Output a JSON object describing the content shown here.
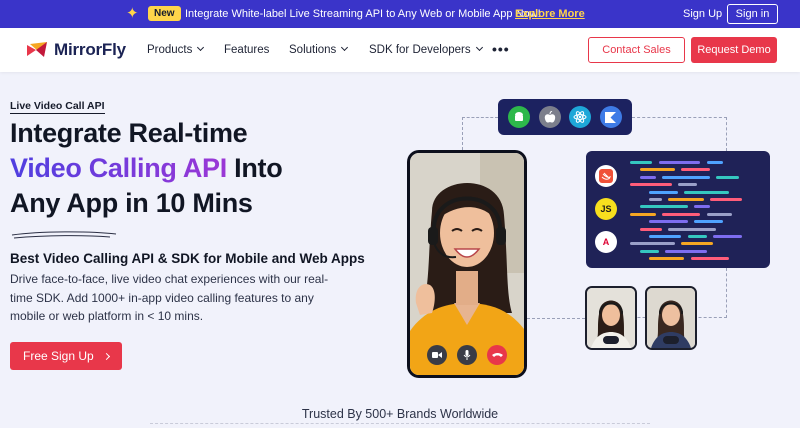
{
  "announcement": {
    "badge": "New",
    "text": "Integrate White-label Live Streaming API to Any Web or Mobile App Now!",
    "link": "Explore More",
    "sign_up": "Sign Up",
    "sign_in": "Sign in"
  },
  "nav": {
    "logo": "MirrorFly",
    "items": [
      "Products",
      "Features",
      "Solutions",
      "SDK for Developers"
    ],
    "more": "•••",
    "contact": "Contact Sales",
    "demo": "Request Demo"
  },
  "hero": {
    "eyebrow": "Live Video Call API",
    "headline_1": "Integrate Real-time",
    "headline_2a": "Video Calling API",
    "headline_2b": " Into",
    "headline_3": "Any App in 10 Mins",
    "subhead": "Best Video Calling API & SDK for Mobile and Web Apps",
    "body": "Drive face-to-face, live video chat experiences with our real-time SDK. Add 1000+ in-app video calling features to any mobile or web platform in < 10 mins.",
    "cta": "Free Sign Up"
  },
  "illustration": {
    "platforms": [
      "android-icon",
      "apple-icon",
      "react-icon",
      "kotlin-icon"
    ],
    "code_langs": [
      "swift-icon",
      "js-icon",
      "angular-icon"
    ],
    "js_label": "JS",
    "angular_label": "A"
  },
  "trusted": "Trusted By 500+ Brands Worldwide",
  "colors": {
    "primary": "#e8374a",
    "topbar": "#3a34c9",
    "accent_yellow": "#ffd54a",
    "navy": "#1c2260"
  }
}
